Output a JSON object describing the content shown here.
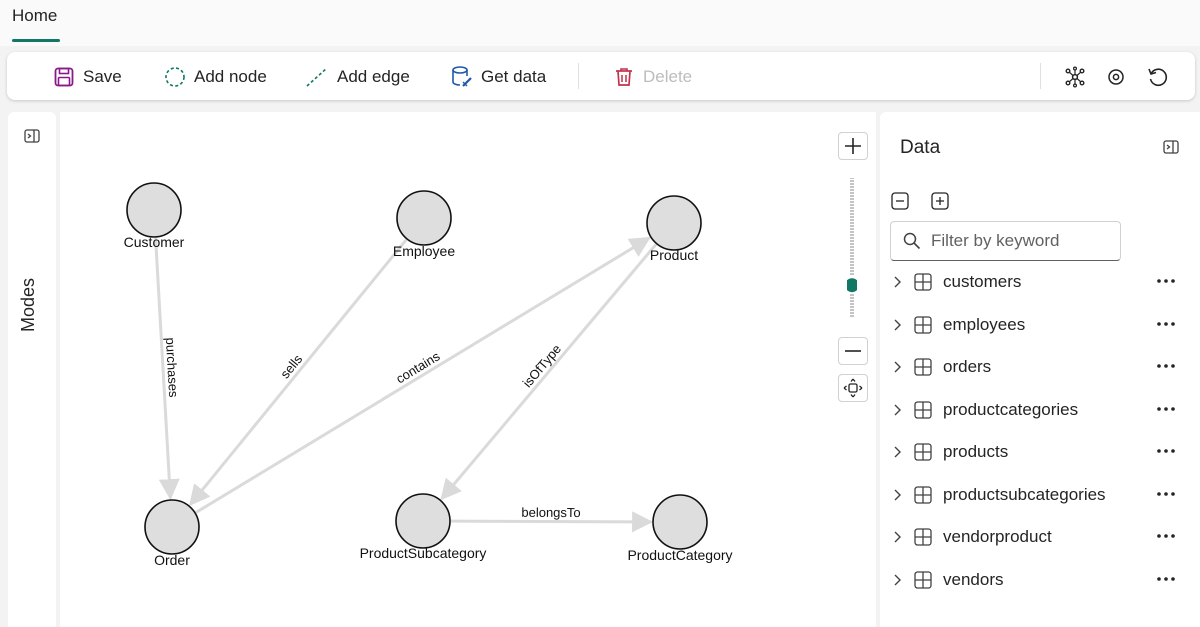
{
  "tab": {
    "home": "Home"
  },
  "toolbar": {
    "save": "Save",
    "add_node": "Add node",
    "add_edge": "Add edge",
    "get_data": "Get data",
    "delete": "Delete"
  },
  "modes": {
    "label": "Modes"
  },
  "graph": {
    "nodes": [
      {
        "id": "customer",
        "label": "Customer"
      },
      {
        "id": "employee",
        "label": "Employee"
      },
      {
        "id": "product",
        "label": "Product"
      },
      {
        "id": "order",
        "label": "Order"
      },
      {
        "id": "productsubcategory",
        "label": "ProductSubcategory"
      },
      {
        "id": "productcategory",
        "label": "ProductCategory"
      }
    ],
    "edges": [
      {
        "from": "customer",
        "to": "order",
        "label": "purchases"
      },
      {
        "from": "employee",
        "to": "order",
        "label": "sells"
      },
      {
        "from": "order",
        "to": "product",
        "label": "contains"
      },
      {
        "from": "product",
        "to": "productsubcategory",
        "label": "isOfType"
      },
      {
        "from": "productsubcategory",
        "to": "productcategory",
        "label": "belongsTo"
      }
    ],
    "zoom_level": 0.2
  },
  "data_panel": {
    "title": "Data",
    "filter_placeholder": "Filter by keyword",
    "tables": [
      {
        "name": "customers"
      },
      {
        "name": "employees"
      },
      {
        "name": "orders"
      },
      {
        "name": "productcategories"
      },
      {
        "name": "products"
      },
      {
        "name": "productsubcategories"
      },
      {
        "name": "vendorproduct"
      },
      {
        "name": "vendors"
      }
    ]
  },
  "colors": {
    "accent": "#117865",
    "delete": "#c4314b",
    "save_icon": "#8a1a8a",
    "get_data_icon": "#1e5aa8",
    "node_fill": "#dedede",
    "edge": "#dadada"
  }
}
